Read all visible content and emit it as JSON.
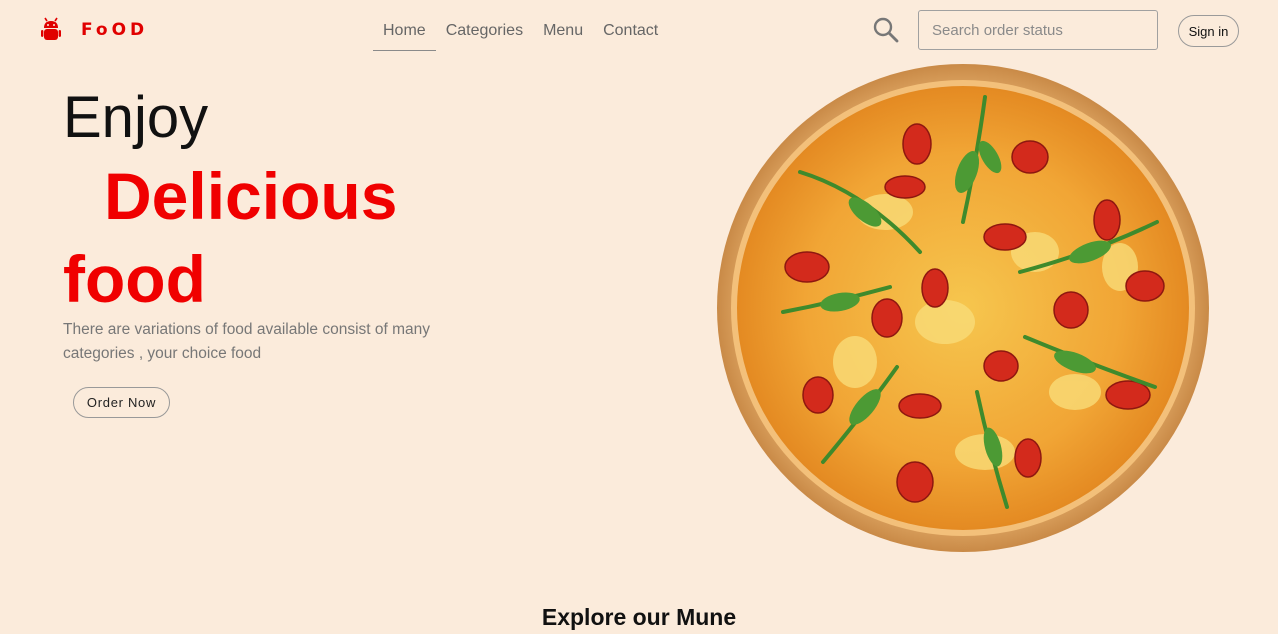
{
  "brand": {
    "name": "FoOD",
    "accent": "#e00000"
  },
  "nav": {
    "links": [
      {
        "label": "Home",
        "active": true
      },
      {
        "label": "Categories",
        "active": false
      },
      {
        "label": "Menu",
        "active": false
      },
      {
        "label": "Contact",
        "active": false
      }
    ]
  },
  "search": {
    "placeholder": "Search order status",
    "value": ""
  },
  "signin": {
    "label": "Sign in"
  },
  "hero": {
    "line1": "Enjoy",
    "line2": "Delicious",
    "line3": "food",
    "description": "There are variations of food available consist of many categories , your choice food",
    "cta_label": "Order Now"
  },
  "section": {
    "title": "Explore our Mune"
  },
  "colors": {
    "background": "#fbebdb",
    "highlight": "#f00000",
    "muted_text": "#777777"
  }
}
